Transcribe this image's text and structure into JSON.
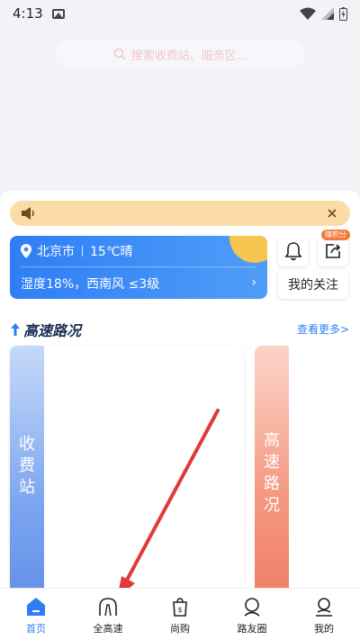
{
  "status_bar": {
    "time": "4:13"
  },
  "search": {
    "placeholder": "搜索收费站、服务区..."
  },
  "notice": {
    "text": ""
  },
  "weather": {
    "city": "北京市",
    "condition": "15℃晴",
    "detail": "湿度18%，西南风 ≤3级",
    "arrow": "›"
  },
  "actions": {
    "points_badge": "赚积分",
    "follow_label": "我的关注"
  },
  "section": {
    "title": "高速路况",
    "more": "查看更多>"
  },
  "panels": {
    "left_strip": [
      "收",
      "费",
      "站"
    ],
    "right_strip": [
      "高",
      "速",
      "路",
      "况"
    ]
  },
  "nav": {
    "items": [
      {
        "label": "首页",
        "active": true
      },
      {
        "label": "全高速"
      },
      {
        "label": "尚购"
      },
      {
        "label": "路友圈"
      },
      {
        "label": "我的"
      }
    ]
  },
  "colors": {
    "accent": "#2f7ef5",
    "notice_bg": "#fbdca6",
    "badge": "#f5793a",
    "arrow": "#e03a3a"
  }
}
